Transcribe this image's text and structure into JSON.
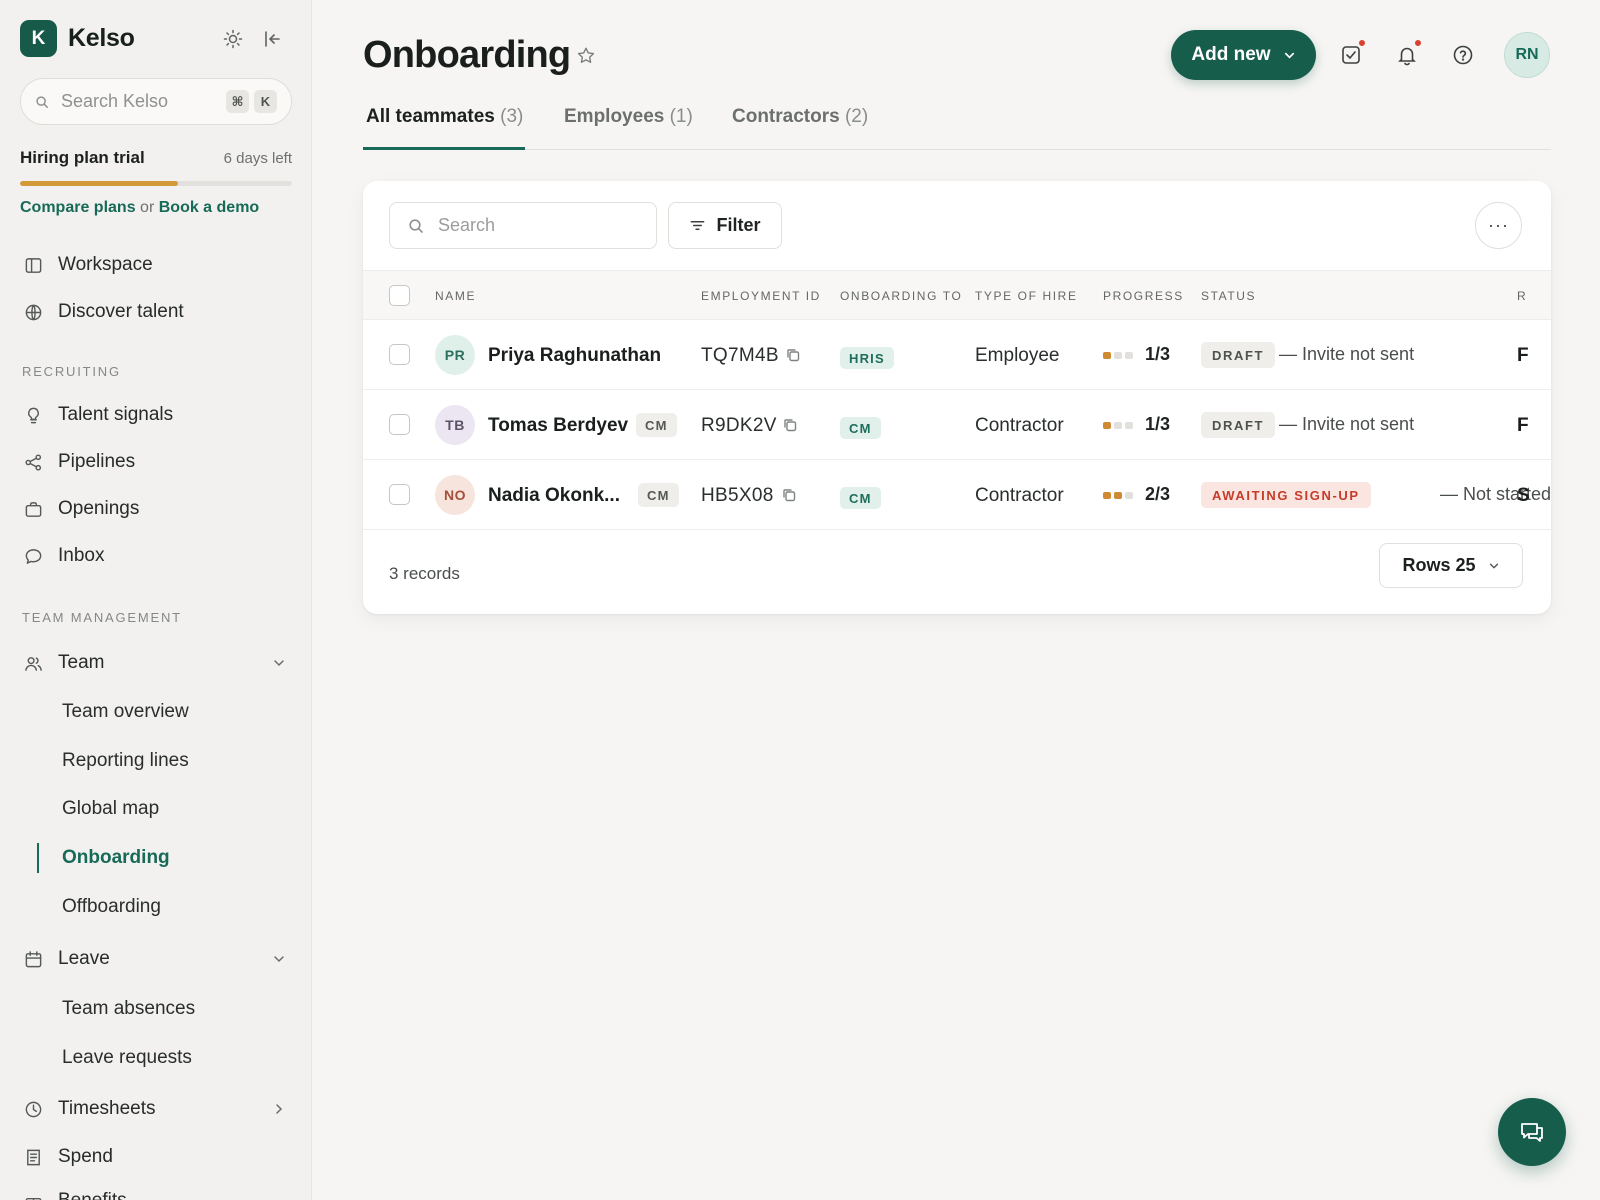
{
  "app": {
    "logo_letter": "K",
    "name": "Kelso"
  },
  "sidebar": {
    "search": {
      "placeholder": "Search Kelso",
      "shortcut_mod": "⌘",
      "shortcut_key": "K"
    },
    "trial": {
      "title": "Hiring plan trial",
      "days_left": "6 days left",
      "progress": 0.58,
      "compare_label": "Compare plans",
      "or_label": "or",
      "demo_label": "Book a demo"
    },
    "top_items": [
      {
        "label": "Workspace",
        "icon": "panel-icon"
      },
      {
        "label": "Discover talent",
        "icon": "globe-icon"
      }
    ],
    "recruiting_label": "RECRUITING",
    "recruiting_items": [
      {
        "label": "Talent signals",
        "icon": "lightbulb-icon"
      },
      {
        "label": "Pipelines",
        "icon": "share-nodes-icon"
      },
      {
        "label": "Openings",
        "icon": "briefcase-icon"
      },
      {
        "label": "Inbox",
        "icon": "chat-bubble-icon"
      }
    ],
    "team_mgmt_label": "TEAM MANAGEMENT",
    "team": {
      "label": "Team",
      "children": [
        "Team overview",
        "Reporting lines",
        "Global map",
        "Onboarding",
        "Offboarding"
      ],
      "active": "Onboarding"
    },
    "leave": {
      "label": "Leave",
      "children": [
        "Team absences",
        "Leave requests"
      ]
    },
    "timesheets_label": "Timesheets",
    "spend_label": "Spend",
    "benefits_label": "Benefits"
  },
  "header": {
    "title": "Onboarding",
    "add_new_label": "Add new",
    "avatar_initials": "RN"
  },
  "tabs": [
    {
      "label": "All teammates",
      "count": "(3)"
    },
    {
      "label": "Employees",
      "count": "(1)"
    },
    {
      "label": "Contractors",
      "count": "(2)"
    }
  ],
  "table": {
    "search_placeholder": "Search",
    "filter_label": "Filter",
    "more_label": "···",
    "columns": [
      "NAME",
      "EMPLOYMENT ID",
      "ONBOARDING TO",
      "TYPE OF HIRE",
      "PROGRESS",
      "STATUS",
      "R"
    ],
    "rows": [
      {
        "initials": "PR",
        "name": "Priya Raghunathan",
        "tag": "",
        "emp_id": "TQ7M4B",
        "onboarding_to": "HRIS",
        "hire": "Employee",
        "progress": "1/3",
        "progress_done": 1,
        "status": "DRAFT",
        "note": "— Invite not sent",
        "clip": "F"
      },
      {
        "initials": "TB",
        "name": "Tomas Berdyev",
        "tag": "CM",
        "emp_id": "R9DK2V",
        "onboarding_to": "CM",
        "hire": "Contractor",
        "progress": "1/3",
        "progress_done": 1,
        "status": "DRAFT",
        "note": "— Invite not sent",
        "clip": "F"
      },
      {
        "initials": "NO",
        "name": "Nadia Okonk...",
        "tag": "CM",
        "emp_id": "HB5X08",
        "onboarding_to": "CM",
        "hire": "Contractor",
        "progress": "2/3",
        "progress_done": 2,
        "status": "AWAITING SIGN-UP",
        "note": "— Not started",
        "clip": "S"
      }
    ],
    "records_label": "3 records",
    "rows_label": "Rows 25"
  },
  "colors": {
    "brand": "#165d4c",
    "accent_link": "#186a58",
    "progress": "#cf8a33",
    "alert": "#d9412f"
  }
}
